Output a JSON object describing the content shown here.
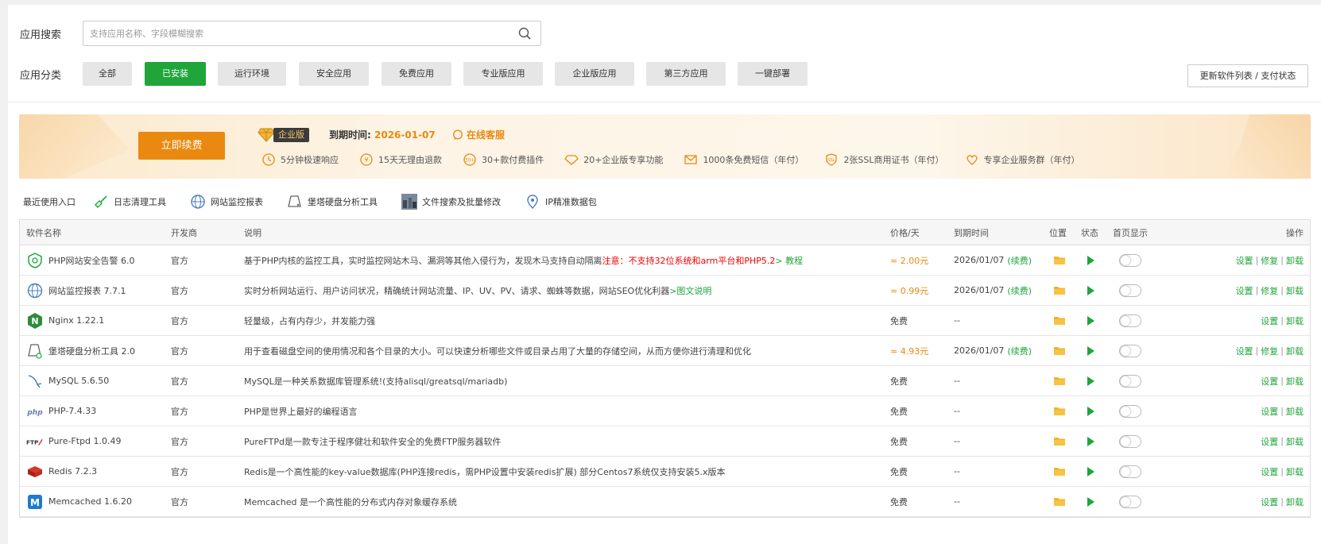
{
  "search": {
    "label": "应用搜索",
    "placeholder": "支持应用名称、字段模糊搜索",
    "value": ""
  },
  "categories": {
    "label": "应用分类",
    "items": [
      "全部",
      "已安装",
      "运行环境",
      "安全应用",
      "免费应用",
      "专业版应用",
      "企业版应用",
      "第三方应用",
      "一键部署"
    ],
    "active": "已安装"
  },
  "update_button": "更新软件列表 / 支付状态",
  "banner": {
    "renew_button": "立即续费",
    "badge": "企业版",
    "expire_label": "到期时间:",
    "expire_date": "2026-01-07",
    "service_link": "在线客服",
    "perks": [
      "5分钟极速响应",
      "15天无理由退款",
      "30+款付费插件",
      "20+企业版专享功能",
      "1000条免费短信（年付）",
      "2张SSL商用证书（年付）",
      "专享企业服务群（年付）"
    ],
    "accent_color": "#e9890f"
  },
  "recent": {
    "label": "最近使用入口",
    "items": [
      "日志清理工具",
      "网站监控报表",
      "堡塔硬盘分析工具",
      "文件搜索及批量修改",
      "IP精准数据包"
    ]
  },
  "table": {
    "headers": {
      "name": "软件名称",
      "dev": "开发商",
      "desc": "说明",
      "price": "价格/天",
      "expire": "到期时间",
      "location": "位置",
      "status": "状态",
      "home": "首页显示",
      "ops": "操作"
    },
    "rows": [
      {
        "name": "PHP网站安全告警 6.0",
        "dev": "官方",
        "desc": "基于PHP内核的监控工具，实时监控网站木马、漏洞等其他入侵行为，发现木马支持自动隔离",
        "warn": "注意：不支持32位系统和arm平台和PHP5.2",
        "link": "> 教程",
        "price": "≈ 2.00元",
        "expire": "2026/01/07",
        "renew": "(续费)",
        "ops": [
          "设置",
          "修复",
          "卸载"
        ],
        "icon": "php-security-icon"
      },
      {
        "name": "网站监控报表 7.7.1",
        "dev": "官方",
        "desc": "实时分析网站运行、用户访问状况，精确统计网站流量、IP、UV、PV、请求、蜘蛛等数据，网站SEO优化利器",
        "warn": "",
        "link": ">图文说明",
        "price": "≈ 0.99元",
        "expire": "2026/01/07",
        "renew": "(续费)",
        "ops": [
          "设置",
          "修复",
          "卸载"
        ],
        "icon": "site-monitor-icon"
      },
      {
        "name": "Nginx 1.22.1",
        "dev": "官方",
        "desc": "轻量级，占有内存少，并发能力强",
        "warn": "",
        "link": "",
        "price": "免费",
        "expire": "--",
        "renew": "",
        "ops": [
          "设置",
          "卸载"
        ],
        "icon": "nginx-icon"
      },
      {
        "name": "堡塔硬盘分析工具 2.0",
        "dev": "官方",
        "desc": "用于查看磁盘空间的使用情况和各个目录的大小。可以快速分析哪些文件或目录占用了大量的存储空间，从而方便你进行清理和优化",
        "warn": "",
        "link": "",
        "price": "≈ 4.93元",
        "expire": "2026/01/07",
        "renew": "(续费)",
        "ops": [
          "设置",
          "修复",
          "卸载"
        ],
        "icon": "disk-analysis-icon"
      },
      {
        "name": "MySQL 5.6.50",
        "dev": "官方",
        "desc": "MySQL是一种关系数据库管理系统!(支持alisql/greatsql/mariadb)",
        "warn": "",
        "link": "",
        "price": "免费",
        "expire": "--",
        "renew": "",
        "ops": [
          "设置",
          "卸载"
        ],
        "icon": "mysql-icon"
      },
      {
        "name": "PHP-7.4.33",
        "dev": "官方",
        "desc": "PHP是世界上最好的编程语言",
        "warn": "",
        "link": "",
        "price": "免费",
        "expire": "--",
        "renew": "",
        "ops": [
          "设置",
          "卸载"
        ],
        "icon": "php-icon"
      },
      {
        "name": "Pure-Ftpd 1.0.49",
        "dev": "官方",
        "desc": "PureFTPd是一款专注于程序健壮和软件安全的免费FTP服务器软件",
        "warn": "",
        "link": "",
        "price": "免费",
        "expire": "--",
        "renew": "",
        "ops": [
          "设置",
          "卸载"
        ],
        "icon": "ftp-icon"
      },
      {
        "name": "Redis 7.2.3",
        "dev": "官方",
        "desc": "Redis是一个高性能的key-value数据库(PHP连接redis，需PHP设置中安装redis扩展) 部分Centos7系统仅支持安装5.x版本",
        "warn": "",
        "link": "",
        "price": "免费",
        "expire": "--",
        "renew": "",
        "ops": [
          "设置",
          "卸载"
        ],
        "icon": "redis-icon"
      },
      {
        "name": "Memcached 1.6.20",
        "dev": "官方",
        "desc": "Memcached 是一个高性能的分布式内存对象缓存系统",
        "warn": "",
        "link": "",
        "price": "免费",
        "expire": "--",
        "renew": "",
        "ops": [
          "设置",
          "卸载"
        ],
        "icon": "memcached-icon"
      }
    ]
  }
}
